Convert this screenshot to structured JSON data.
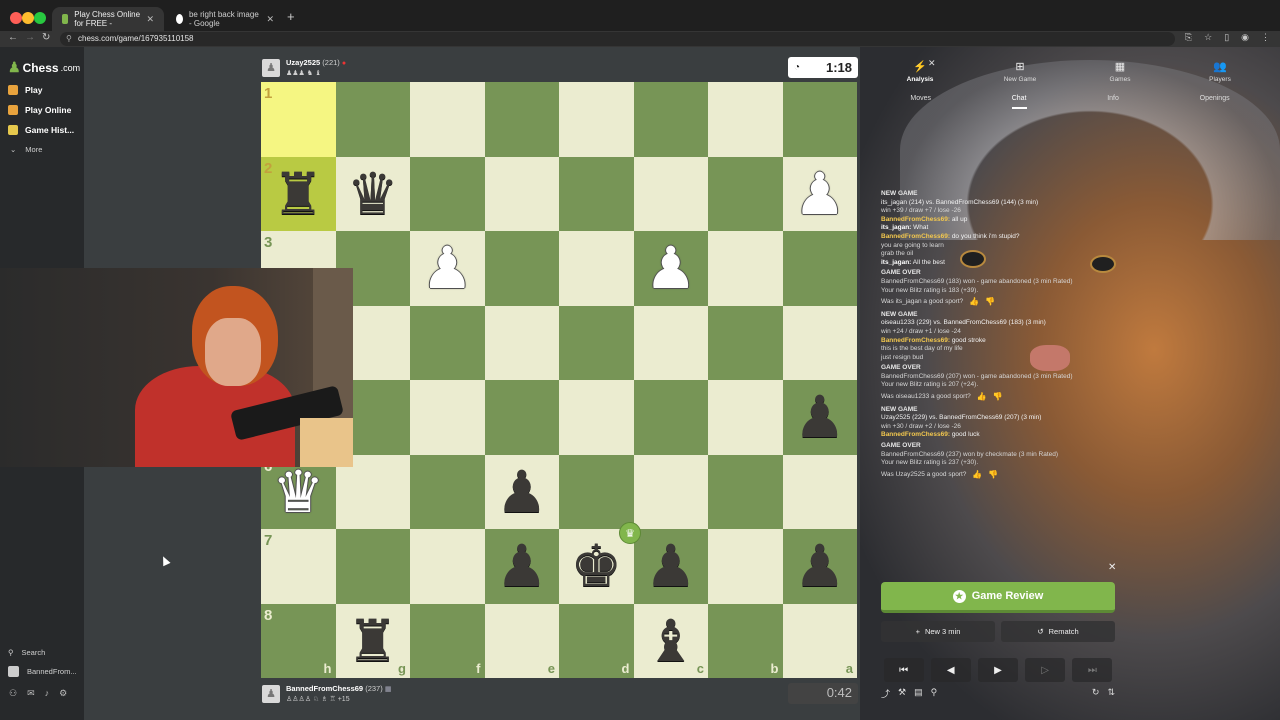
{
  "browser": {
    "tabs": [
      {
        "title": "Play Chess Online for FREE -",
        "active": true
      },
      {
        "title": "be right back image - Google",
        "active": false
      }
    ],
    "url": "chess.com/game/167935110158"
  },
  "sidebar": {
    "logo": "Chess",
    "logo_suffix": ".com",
    "items": [
      {
        "label": "Play"
      },
      {
        "label": "Play Online"
      },
      {
        "label": "Game Hist..."
      }
    ],
    "more_label": "More",
    "search_label": "Search",
    "user_label": "BannedFrom..."
  },
  "top_player": {
    "name": "Uzay2525",
    "rating": "(221)",
    "material": "♟♟♟ ♞ ♝",
    "clock": "1:18"
  },
  "bottom_player": {
    "name": "BannedFromChess69",
    "rating": "(237)",
    "material": "♙♙♙♙ ♘ ♗ ♖ +15",
    "clock": "0:42"
  },
  "board": {
    "ranks": [
      "1",
      "2",
      "3",
      "4",
      "5",
      "6",
      "7",
      "8"
    ],
    "files": [
      "h",
      "g",
      "f",
      "e",
      "d",
      "c",
      "b",
      "a"
    ],
    "pieces": [
      {
        "sq": [
          1,
          0
        ],
        "glyph": "♜",
        "color": "b"
      },
      {
        "sq": [
          1,
          1
        ],
        "glyph": "♛",
        "color": "b"
      },
      {
        "sq": [
          1,
          7
        ],
        "glyph": "♟",
        "color": "w"
      },
      {
        "sq": [
          2,
          2
        ],
        "glyph": "♟",
        "color": "w"
      },
      {
        "sq": [
          2,
          5
        ],
        "glyph": "♟",
        "color": "w"
      },
      {
        "sq": [
          4,
          7
        ],
        "glyph": "♟",
        "color": "b"
      },
      {
        "sq": [
          5,
          0
        ],
        "glyph": "♛",
        "color": "w"
      },
      {
        "sq": [
          5,
          3
        ],
        "glyph": "♟",
        "color": "b"
      },
      {
        "sq": [
          6,
          3
        ],
        "glyph": "♟",
        "color": "b"
      },
      {
        "sq": [
          6,
          4
        ],
        "glyph": "♚",
        "color": "b"
      },
      {
        "sq": [
          6,
          5
        ],
        "glyph": "♟",
        "color": "b"
      },
      {
        "sq": [
          6,
          7
        ],
        "glyph": "♟",
        "color": "b"
      },
      {
        "sq": [
          7,
          1
        ],
        "glyph": "♜",
        "color": "b"
      },
      {
        "sq": [
          7,
          5
        ],
        "glyph": "♝",
        "color": "b"
      }
    ],
    "highlights": [
      [
        0,
        0
      ],
      [
        1,
        0
      ]
    ]
  },
  "panel": {
    "top_tabs": [
      {
        "label": "Analysis",
        "icon": "⚡",
        "active": true
      },
      {
        "label": "New Game",
        "icon": "⊞",
        "active": false
      },
      {
        "label": "Games",
        "icon": "▦",
        "active": false
      },
      {
        "label": "Players",
        "icon": "👥",
        "active": false
      }
    ],
    "sub_tabs": [
      {
        "label": "Moves",
        "active": false
      },
      {
        "label": "Chat",
        "active": true
      },
      {
        "label": "Info",
        "active": false
      },
      {
        "label": "Openings",
        "active": false
      }
    ],
    "chat": [
      {
        "type": "hdr",
        "text": "NEW GAME"
      },
      {
        "type": "vs",
        "text": "its_jagan (214) vs. BannedFromChess69 (144) (3 min)"
      },
      {
        "type": "sub",
        "text": "win +39 / draw +7 / lose -26"
      },
      {
        "type": "msg",
        "user": "BannedFromChess69:",
        "ucls": "u2",
        "text": "all up"
      },
      {
        "type": "msg",
        "user": "its_jagan:",
        "ucls": "u1",
        "text": "What"
      },
      {
        "type": "msg",
        "user": "BannedFromChess69:",
        "ucls": "u2",
        "text": "do you think i'm stupid?"
      },
      {
        "type": "sub",
        "text": "you are going to learn"
      },
      {
        "type": "sub",
        "text": "grab the oil"
      },
      {
        "type": "msg",
        "user": "its_jagan:",
        "ucls": "u1",
        "text": "All the best"
      },
      {
        "type": "hdr",
        "text": "GAME OVER"
      },
      {
        "type": "sub",
        "text": "BannedFromChess69 (183) won - game abandoned (3 min Rated)"
      },
      {
        "type": "sub",
        "text": "Your new Blitz rating is 183 (+39)."
      },
      {
        "type": "ask",
        "text": "Was its_jagan a good sport?"
      },
      {
        "type": "hdr",
        "text": "NEW GAME"
      },
      {
        "type": "vs",
        "text": "oiseau1233 (229) vs. BannedFromChess69 (183) (3 min)"
      },
      {
        "type": "sub",
        "text": "win +24 / draw +1 / lose -24"
      },
      {
        "type": "msg",
        "user": "BannedFromChess69:",
        "ucls": "u2",
        "text": "good stroke"
      },
      {
        "type": "sub",
        "text": "this is the best day of my life"
      },
      {
        "type": "sub",
        "text": "just resign bud"
      },
      {
        "type": "hdr",
        "text": "GAME OVER"
      },
      {
        "type": "sub",
        "text": "BannedFromChess69 (207) won - game abandoned (3 min Rated)"
      },
      {
        "type": "sub",
        "text": "Your new Blitz rating is 207 (+24)."
      },
      {
        "type": "ask",
        "text": "Was oiseau1233 a good sport?"
      },
      {
        "type": "hdr",
        "text": "NEW GAME"
      },
      {
        "type": "vs",
        "text": "Uzay2525 (229) vs. BannedFromChess69 (207) (3 min)"
      },
      {
        "type": "sub",
        "text": "win +30 / draw +2 / lose -26"
      },
      {
        "type": "msg",
        "user": "BannedFromChess69:",
        "ucls": "u2",
        "text": "good luck"
      },
      {
        "type": "hdr",
        "text": "GAME OVER"
      },
      {
        "type": "sub",
        "text": "BannedFromChess69 (237) won by checkmate (3 min Rated)"
      },
      {
        "type": "sub",
        "text": "Your new Blitz rating is 237 (+30)."
      },
      {
        "type": "ask",
        "text": "Was Uzay2525 a good sport?"
      }
    ],
    "review_label": "Game Review",
    "new_game_label": "New 3 min",
    "rematch_label": "Rematch",
    "accent": "#81b64c"
  }
}
